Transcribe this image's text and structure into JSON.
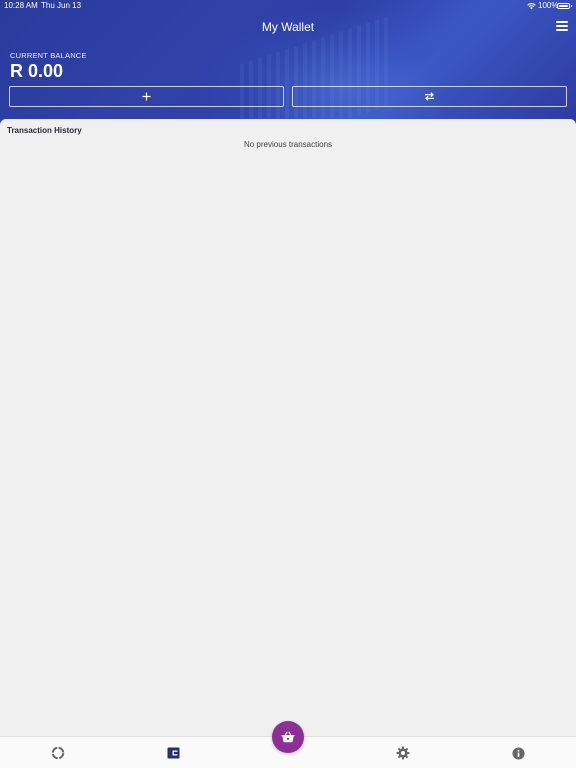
{
  "status_bar": {
    "time": "10:28 AM",
    "date": "Thu Jun 13",
    "battery": "100%"
  },
  "header": {
    "title": "My Wallet",
    "balance_label": "CURRENT BALANCE",
    "balance_value": "R 0.00",
    "actions": [
      {
        "name": "add",
        "icon": "plus-icon"
      },
      {
        "name": "transfer",
        "icon": "transfer-arrows-icon"
      }
    ]
  },
  "transactions": {
    "title": "Transaction History",
    "empty_message": "No previous transactions"
  },
  "tab_bar": {
    "items": [
      {
        "name": "loading",
        "icon": "spinner-icon"
      },
      {
        "name": "wallet",
        "icon": "wallet-icon",
        "active": true
      },
      {
        "name": "shop",
        "icon": "basket-icon"
      },
      {
        "name": "settings",
        "icon": "gear-icon"
      },
      {
        "name": "info",
        "icon": "info-icon"
      }
    ]
  },
  "colors": {
    "header": "#2e3fa8",
    "fab": "#8e2f96",
    "active_tab": "#2a2f6a",
    "inactive_tab": "#666666"
  }
}
